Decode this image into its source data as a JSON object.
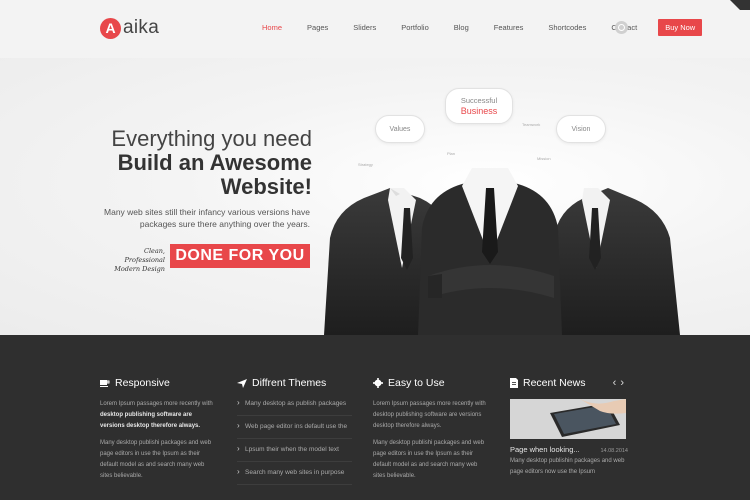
{
  "brand": {
    "mark": "A",
    "name": "aika"
  },
  "nav": {
    "items": [
      "Home",
      "Pages",
      "Sliders",
      "Portfolio",
      "Blog",
      "Features",
      "Shortcodes",
      "Contact"
    ],
    "active": "Home",
    "cta": "Buy Now",
    "search_icon": "search-icon"
  },
  "hero": {
    "line1": "Everything you need",
    "line2": "Build an Awesome",
    "line3": "Website!",
    "description": "Many web sites still their infancy various versions have packages sure there anything over the years.",
    "tagline": "Clean, Professional Modern Design",
    "button": "DONE FOR YOU",
    "bubbles": {
      "successful": "Successful",
      "business": "Business",
      "values": "Values",
      "vision": "Vision"
    },
    "tags": [
      "Teamwork",
      "Strategy",
      "Plan",
      "Mission"
    ]
  },
  "footer": {
    "responsive": {
      "title": "Responsive",
      "icon": "coffee-cup-icon",
      "p1_a": "Lorem Ipsum passages more recently with ",
      "p1_b": "desktop publishing software are versions desktop therefore always.",
      "p2": "Many desktop publishi packages and web page editors in use the Ipsum as their default model as and search many web sites believable."
    },
    "themes": {
      "title": "Diffrent Themes",
      "icon": "paper-plane-icon",
      "items": [
        "Many desktop as publish packages",
        "Web page editor ins default use the",
        "Lpsum their when the model text",
        "Search many web sites in purpose"
      ]
    },
    "easy": {
      "title": "Easy to Use",
      "icon": "gear-icon",
      "p1": "Lorem Ipsum passages more recently with desktop publishing software are versions desktop therefore always.",
      "p2": "Many desktop publishi packages and web page editors in use the Ipsum as their default model as and search many web sites believable."
    },
    "news": {
      "title": "Recent News",
      "icon": "document-icon",
      "prev_icon": "chevron-left-icon",
      "next_icon": "chevron-right-icon",
      "prev": "‹",
      "next": "›",
      "post_title": "Page when looking...",
      "post_date": "14.08.2014",
      "post_excerpt": "Many desktop publishin packages and web page editors now use the Ipsum"
    }
  },
  "colors": {
    "accent": "#e8474a",
    "footer_bg": "#2f2f2f",
    "hero_bg": "#f3f3f3"
  }
}
